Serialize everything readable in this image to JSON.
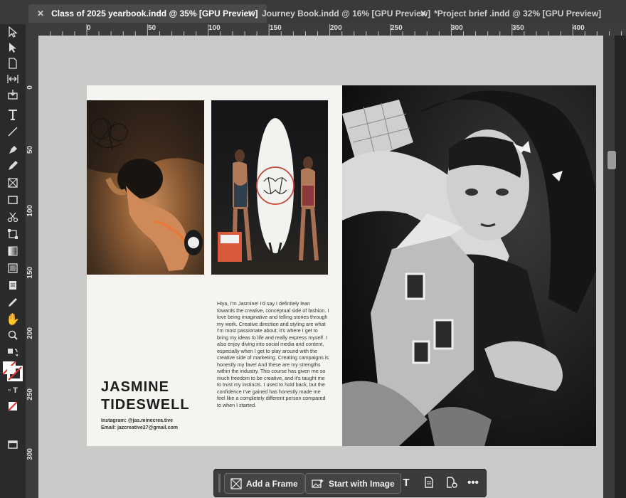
{
  "tabs": [
    {
      "label": "Class of 2025 yearbook.indd @ 35% [GPU Preview]",
      "active": true
    },
    {
      "label": "Journey Book.indd @ 16% [GPU Preview]",
      "active": false
    },
    {
      "label": "*Project brief .indd @ 32% [GPU Preview]",
      "active": false
    }
  ],
  "ruler_top": {
    "labels": [
      "0",
      "50",
      "100",
      "150",
      "200",
      "250",
      "300",
      "350",
      "400"
    ]
  },
  "ruler_left": {
    "labels": [
      "0",
      "50",
      "100",
      "150",
      "200",
      "250",
      "300"
    ]
  },
  "page": {
    "bio": "Hiya, I'm Jasmine! I'd say I definitely lean towards the creative, conceptual side of fashion. I love being imaginative and telling stories through my work. Creative direction and styling are what I'm most passionate about; it's where I get to bring my ideas to life and really express myself. I also enjoy diving into social media and content, especially when I get to play around with the creative side of marketing. Creating campaigns is honestly my fave! And these are my strengths within the industry. This course has given me so much freedom to be creative, and it's taught me to trust my instincts. I used to hold back, but the confidence I've gained has honestly made me feel like a completely different person compared to when I started.",
    "name_line1": "JASMINE",
    "name_line2": "TIDESWELL",
    "instagram": "Instagram: @jas.minecrea.tive",
    "email": "Email: jazcreative27@gmail.com"
  },
  "context_bar": {
    "add_frame": "Add a Frame",
    "start_with_image": "Start with Image"
  },
  "tools": [
    "selection-icon",
    "direct-selection-icon",
    "page-tool-icon",
    "gap-tool-icon",
    "content-collector-icon",
    "type-tool-icon",
    "line-tool-icon",
    "pen-tool-icon",
    "pencil-tool-icon",
    "rectangle-frame-icon",
    "rectangle-tool-icon",
    "scissors-icon",
    "free-transform-icon",
    "gradient-swatch-icon",
    "gradient-feather-icon",
    "note-tool-icon",
    "eyedropper-icon",
    "hand-tool-icon",
    "zoom-tool-icon",
    "swap-fill-stroke-icon",
    "fill-stroke-swatch-icon",
    "formatting-container-icon",
    "apply-none-icon",
    "screen-mode-icon"
  ]
}
